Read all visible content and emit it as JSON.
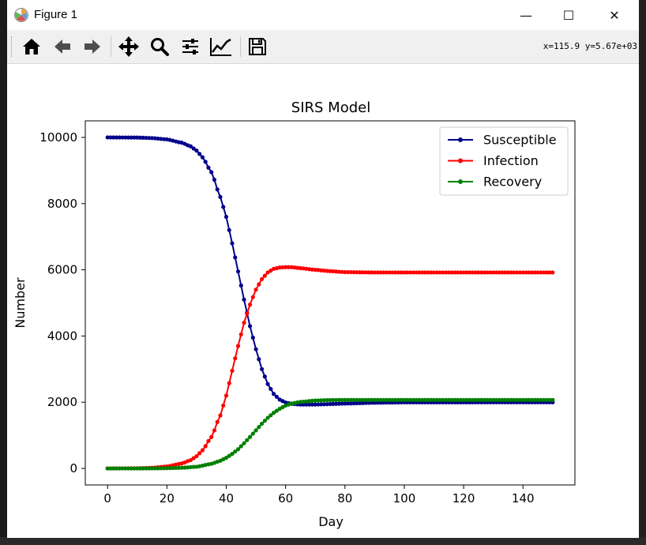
{
  "window": {
    "title": "Figure 1",
    "controls": {
      "minimize": "—",
      "maximize": "☐",
      "close": "✕"
    }
  },
  "toolbar": {
    "tools": [
      "home-icon",
      "back-arrow-icon",
      "forward-arrow-icon",
      "pan-icon",
      "zoom-icon",
      "configure-subplots-icon",
      "edit-axis-icon",
      "save-icon"
    ],
    "coords": "x=115.9 y=5.67e+03"
  },
  "chart_data": {
    "type": "line",
    "title": "SIRS Model",
    "xlabel": "Day",
    "ylabel": "Number",
    "xlim": [
      -7.5,
      157.5
    ],
    "ylim": [
      -500,
      10500
    ],
    "xticks": [
      0,
      20,
      40,
      60,
      80,
      100,
      120,
      140
    ],
    "yticks": [
      0,
      2000,
      4000,
      6000,
      8000,
      10000
    ],
    "grid": false,
    "legend_position": "upper-right",
    "x": [
      0,
      150
    ],
    "series": [
      {
        "name": "Susceptible",
        "color": "#00008b",
        "marker": "circle",
        "points": [
          [
            0,
            10000
          ],
          [
            10,
            9995
          ],
          [
            15,
            9980
          ],
          [
            20,
            9940
          ],
          [
            25,
            9840
          ],
          [
            28,
            9730
          ],
          [
            30,
            9600
          ],
          [
            32,
            9400
          ],
          [
            35,
            8950
          ],
          [
            38,
            8200
          ],
          [
            40,
            7600
          ],
          [
            42,
            6800
          ],
          [
            44,
            5950
          ],
          [
            46,
            5100
          ],
          [
            48,
            4300
          ],
          [
            50,
            3600
          ],
          [
            52,
            3000
          ],
          [
            54,
            2550
          ],
          [
            56,
            2250
          ],
          [
            58,
            2080
          ],
          [
            60,
            1990
          ],
          [
            62,
            1950
          ],
          [
            65,
            1930
          ],
          [
            70,
            1930
          ],
          [
            80,
            1960
          ],
          [
            90,
            1985
          ],
          [
            100,
            1995
          ],
          [
            150,
            2000
          ]
        ]
      },
      {
        "name": "Infection",
        "color": "#ff0000",
        "marker": "circle",
        "points": [
          [
            0,
            0
          ],
          [
            10,
            5
          ],
          [
            15,
            20
          ],
          [
            20,
            60
          ],
          [
            25,
            150
          ],
          [
            28,
            250
          ],
          [
            30,
            370
          ],
          [
            32,
            550
          ],
          [
            35,
            950
          ],
          [
            38,
            1600
          ],
          [
            40,
            2200
          ],
          [
            42,
            2950
          ],
          [
            44,
            3700
          ],
          [
            46,
            4400
          ],
          [
            48,
            4950
          ],
          [
            50,
            5400
          ],
          [
            52,
            5720
          ],
          [
            54,
            5920
          ],
          [
            56,
            6030
          ],
          [
            58,
            6070
          ],
          [
            60,
            6080
          ],
          [
            62,
            6080
          ],
          [
            65,
            6050
          ],
          [
            70,
            6000
          ],
          [
            75,
            5960
          ],
          [
            80,
            5930
          ],
          [
            90,
            5920
          ],
          [
            150,
            5920
          ]
        ]
      },
      {
        "name": "Recovery",
        "color": "#008000",
        "marker": "circle",
        "points": [
          [
            0,
            0
          ],
          [
            10,
            0
          ],
          [
            15,
            2
          ],
          [
            20,
            8
          ],
          [
            25,
            20
          ],
          [
            30,
            50
          ],
          [
            35,
            140
          ],
          [
            38,
            230
          ],
          [
            40,
            320
          ],
          [
            42,
            440
          ],
          [
            44,
            580
          ],
          [
            46,
            760
          ],
          [
            48,
            950
          ],
          [
            50,
            1150
          ],
          [
            52,
            1350
          ],
          [
            54,
            1530
          ],
          [
            56,
            1680
          ],
          [
            58,
            1800
          ],
          [
            60,
            1900
          ],
          [
            62,
            1960
          ],
          [
            65,
            2010
          ],
          [
            70,
            2050
          ],
          [
            75,
            2065
          ],
          [
            80,
            2070
          ],
          [
            150,
            2070
          ]
        ]
      }
    ]
  }
}
